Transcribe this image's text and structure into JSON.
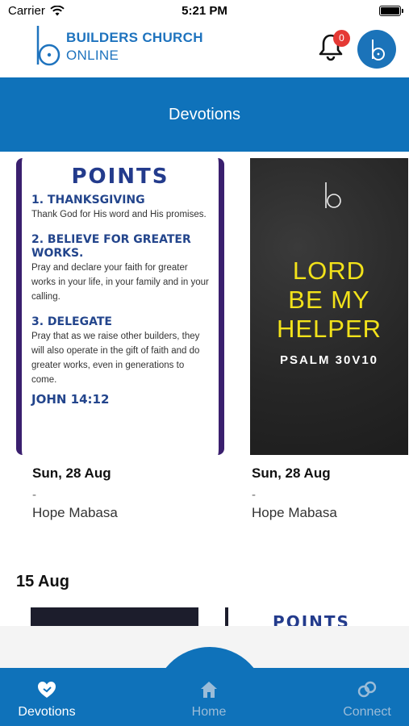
{
  "status_bar": {
    "carrier": "Carrier",
    "time": "5:21 PM"
  },
  "header": {
    "brand_line1": "BUILDERS CHURCH",
    "brand_line2": "ONLINE",
    "notification_count": "0",
    "bell_icon": "bell-icon",
    "avatar_icon": "brand-logo-icon"
  },
  "page_title": "Devotions",
  "cards": [
    {
      "poster": {
        "title": "POINTS",
        "points": [
          {
            "heading": "1. THANKSGIVING",
            "text": "Thank God for His word and His promises."
          },
          {
            "heading": "2. BELIEVE FOR GREATER WORKS.",
            "text": "Pray and declare your faith for greater works in your life, in your family and in your calling."
          },
          {
            "heading": "3. DELEGATE",
            "text": "Pray that as we raise other builders, they will also operate in the gift of faith and do greater works, even in generations to come."
          }
        ],
        "reference": "JOHN 14:12"
      },
      "date": "Sun, 28 Aug",
      "dash": "-",
      "author": "Hope Mabasa"
    },
    {
      "poster": {
        "line1": "LORD",
        "line2": "BE MY",
        "line3": "HELPER",
        "reference": "PSALM 30V10"
      },
      "date": "Sun, 28 Aug",
      "dash": "-",
      "author": "Hope Mabasa"
    }
  ],
  "section_header": "15 Aug",
  "next_thumb_title": "POINTS",
  "bottom_nav": [
    {
      "label": "Devotions",
      "icon": "heart-hands-icon",
      "active": true
    },
    {
      "label": "Home",
      "icon": "home-icon",
      "active": false
    },
    {
      "label": "Connect",
      "icon": "link-icon",
      "active": false
    }
  ],
  "colors": {
    "primary": "#0f72ba",
    "badge": "#e53935",
    "poster_yellow": "#f2e21a",
    "poster_blue": "#23458c"
  }
}
